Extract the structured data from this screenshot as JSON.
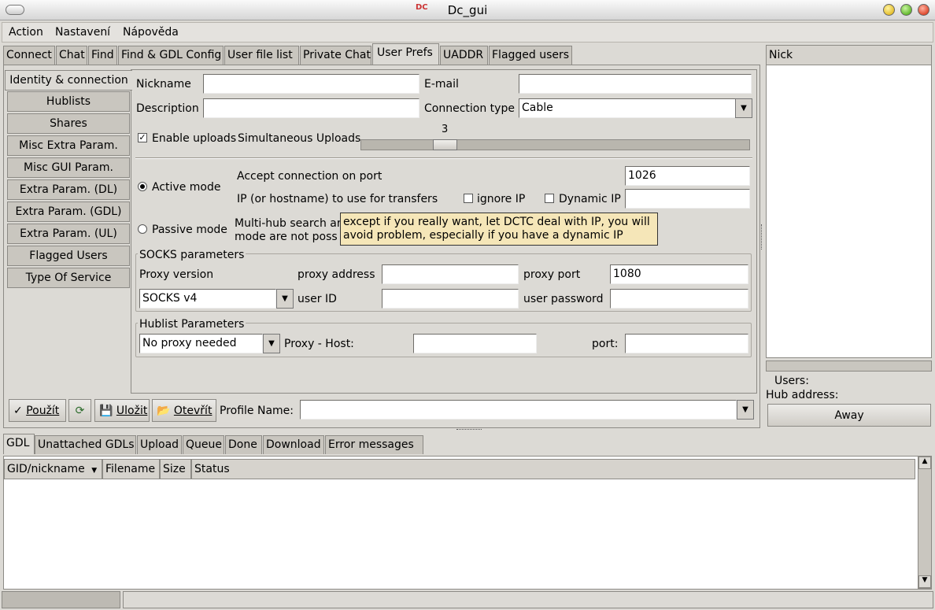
{
  "window": {
    "title": "Dc_gui",
    "icon": "dctc-app-icon"
  },
  "menu": {
    "items": [
      "Action",
      "Nastavení",
      "Nápověda"
    ]
  },
  "tabs": [
    "Connect",
    "Chat",
    "Find",
    "Find & GDL Config",
    "User file list",
    "Private Chat",
    "User Prefs",
    "UADDR",
    "Flagged users"
  ],
  "active_tab": "User Prefs",
  "side_tabs": [
    "Identity & connection",
    "Hublists",
    "Shares",
    "Misc Extra Param.",
    "Misc GUI Param.",
    "Extra Param. (DL)",
    "Extra Param. (GDL)",
    "Extra Param. (UL)",
    "Flagged Users",
    "Type Of Service"
  ],
  "identity": {
    "nickname_label": "Nickname",
    "nickname_value": "",
    "email_label": "E-mail",
    "email_value": "",
    "description_label": "Description",
    "description_value": "",
    "connection_type_label": "Connection type",
    "connection_type_value": "Cable",
    "enable_uploads_label": "Enable uploads",
    "enable_uploads_checked": true,
    "simultaneous_uploads_label": "Simultaneous Uploads",
    "simultaneous_uploads_value": "3",
    "active_mode_label": "Active mode",
    "active_mode_selected": true,
    "accept_port_label": "Accept connection on port",
    "accept_port_value": "1026",
    "ip_label": "IP (or hostname) to use for transfers",
    "ignore_ip_label": "ignore IP",
    "dynamic_ip_label": "Dynamic IP",
    "ip_value": "",
    "passive_mode_label": "Passive mode",
    "passive_note_line1": "Multi-hub search ar",
    "passive_note_line2": "mode are not poss",
    "tooltip_line1": "except if you really want, let DCTC deal with IP, you will",
    "tooltip_line2": "avoid problem, especially if you have a dynamic IP"
  },
  "socks": {
    "title": "SOCKS parameters",
    "proxy_version_label": "Proxy version",
    "proxy_version_value": "SOCKS v4",
    "proxy_address_label": "proxy address",
    "proxy_address_value": "",
    "proxy_port_label": "proxy port",
    "proxy_port_value": "1080",
    "user_id_label": "user ID",
    "user_id_value": "",
    "user_password_label": "user password",
    "user_password_value": ""
  },
  "hublist": {
    "title": "Hublist Parameters",
    "proxy_mode_value": "No proxy needed",
    "proxy_host_label": "Proxy - Host:",
    "proxy_host_value": "",
    "port_label": "port:",
    "port_value": ""
  },
  "toolbar": {
    "apply_label": "Použít",
    "save_label": "Uložit",
    "open_label": "Otevřít",
    "profile_name_label": "Profile Name:",
    "profile_name_value": ""
  },
  "right_panel": {
    "nick_header": "Nick",
    "users_label": "Users:",
    "hub_address_label": "Hub address:",
    "away_label": "Away"
  },
  "bottom_tabs": [
    "GDL",
    "Unattached GDLs",
    "Upload",
    "Queue",
    "Done",
    "Download",
    "Error messages"
  ],
  "bottom_active_tab": "GDL",
  "table": {
    "columns": [
      "GID/nickname",
      "Filename",
      "Size",
      "Status"
    ]
  }
}
